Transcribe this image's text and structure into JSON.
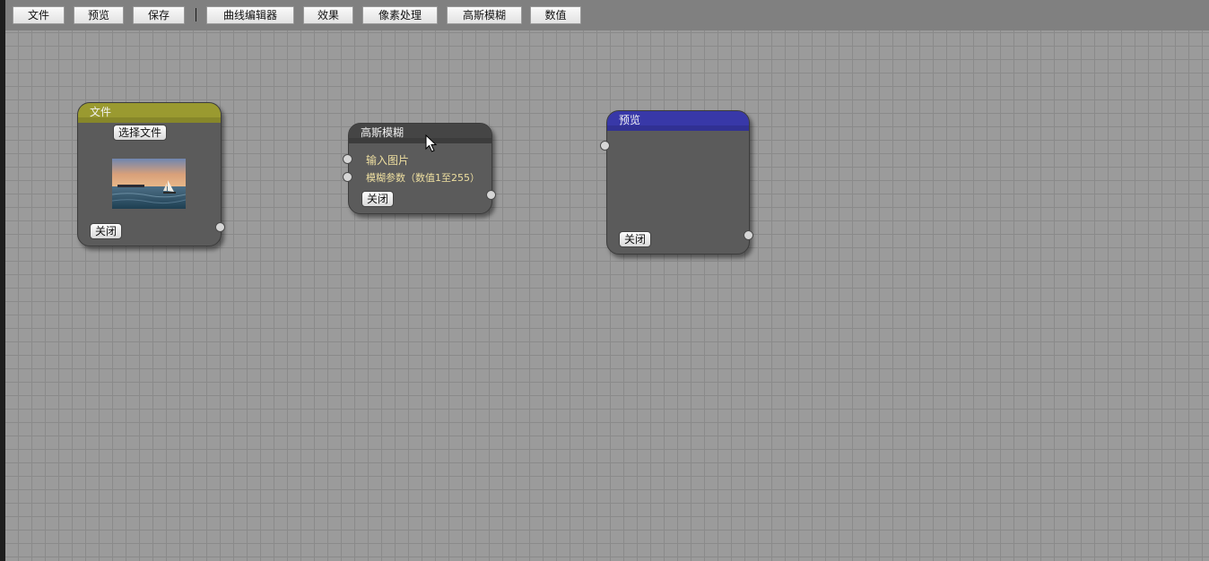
{
  "toolbar": {
    "buttons": [
      "文件",
      "预览",
      "保存",
      "曲线编辑器",
      "效果",
      "像素处理",
      "高斯模糊",
      "数值"
    ]
  },
  "nodes": {
    "file": {
      "title": "文件",
      "choose_file_label": "选择文件",
      "close_label": "关闭",
      "header_color": "#9a9a30"
    },
    "blur": {
      "title": "高斯模糊",
      "inputs": [
        "输入图片",
        "模糊参数（数值1至255）"
      ],
      "close_label": "关闭",
      "header_color": "#454545"
    },
    "preview": {
      "title": "预览",
      "close_label": "关闭",
      "header_color": "#3838a8"
    }
  }
}
